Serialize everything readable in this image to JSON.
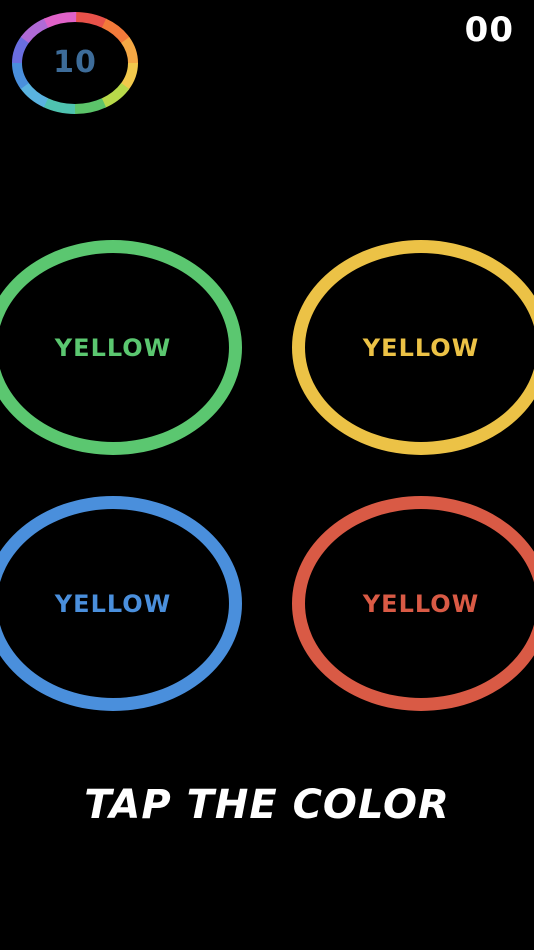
{
  "timer": {
    "value": "10",
    "text_color": "#3d6c99",
    "segment_colors": [
      "#e8524a",
      "#f27a3a",
      "#f5a845",
      "#f2c94c",
      "#b8d94a",
      "#5cc46a",
      "#4fc3b0",
      "#5ab3e0",
      "#4a8fdc",
      "#6a6ee0",
      "#b06ad6",
      "#e062c8"
    ]
  },
  "score": {
    "value": "00",
    "color": "#ffffff"
  },
  "rings": [
    {
      "id": "ring-tl",
      "label": "YELLOW",
      "color": "#5bc770",
      "name": "green"
    },
    {
      "id": "ring-tr",
      "label": "YELLOW",
      "color": "#ecc246",
      "name": "yellow"
    },
    {
      "id": "ring-bl",
      "label": "YELLOW",
      "color": "#4a8fdc",
      "name": "blue"
    },
    {
      "id": "ring-br",
      "label": "YELLOW",
      "color": "#d95a45",
      "name": "red"
    }
  ],
  "instruction": {
    "text": "TAP THE COLOR",
    "color": "#ffffff"
  }
}
